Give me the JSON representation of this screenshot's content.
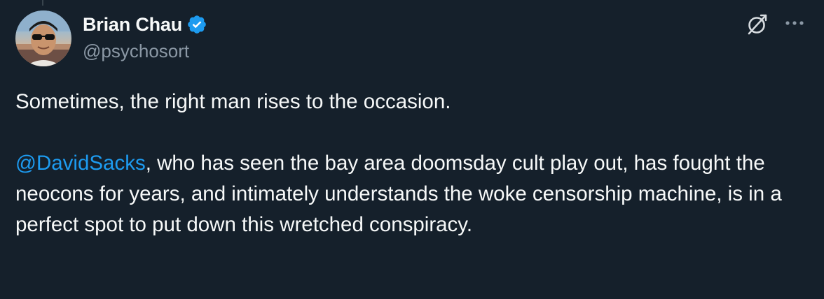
{
  "author": {
    "display_name": "Brian Chau",
    "handle": "@psychosort",
    "verified": true
  },
  "tweet": {
    "line1": "Sometimes, the right man rises to the occasion.",
    "mention": "@DavidSacks",
    "line2_rest": ", who has seen the bay area doomsday cult play out, has fought the neocons for years, and intimately understands the woke censorship machine, is in a perfect spot to put down this wretched conspiracy."
  },
  "icons": {
    "verified": "verified-badge-icon",
    "grok": "grok-icon",
    "more": "more-options-icon"
  },
  "colors": {
    "background": "#15202b",
    "text": "#f7f9f9",
    "secondary_text": "#8b98a5",
    "accent": "#1d9bf0"
  }
}
